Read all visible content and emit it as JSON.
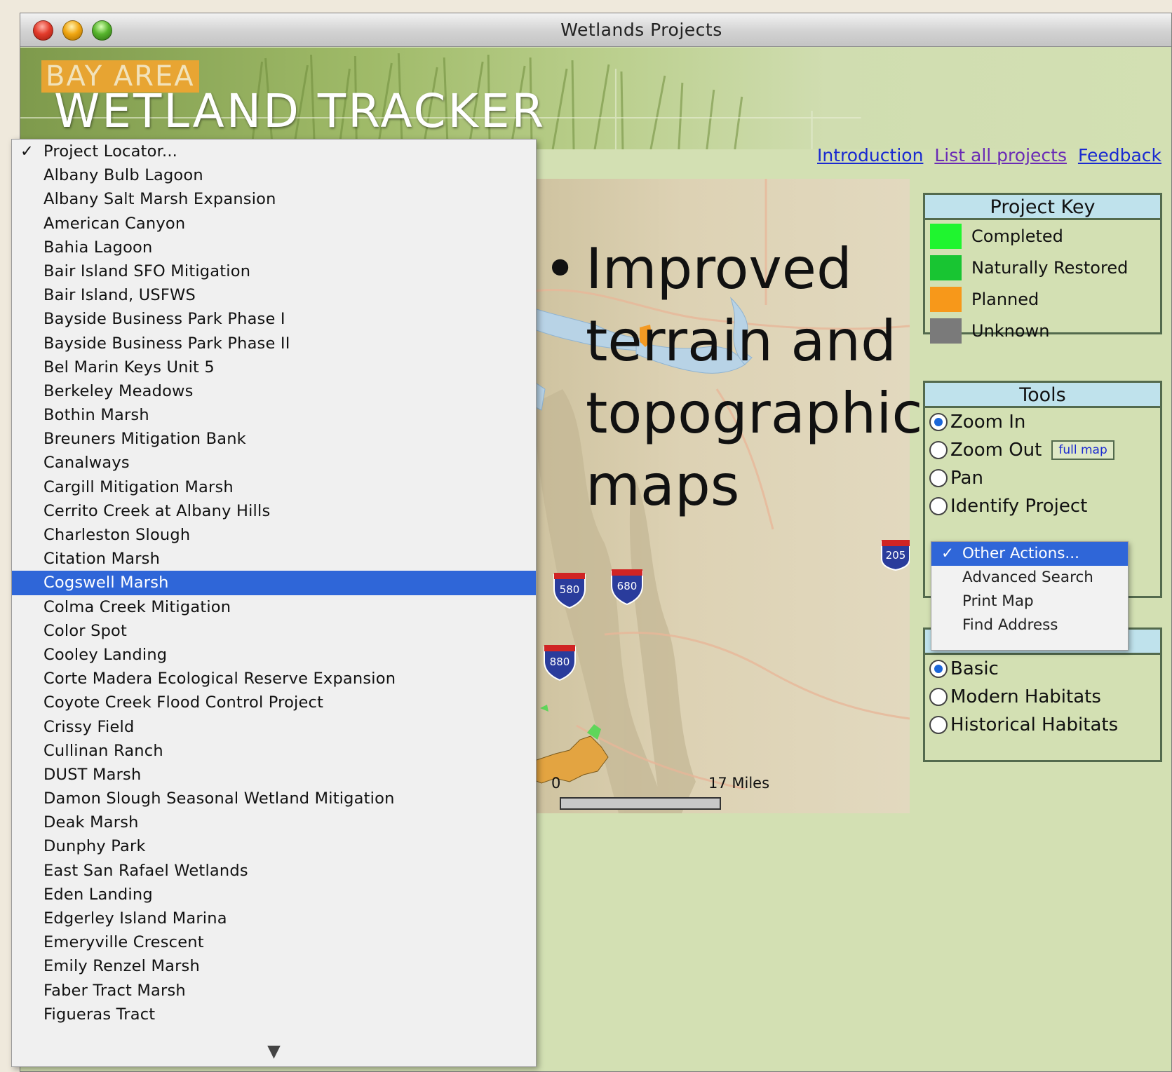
{
  "window": {
    "title": "Wetlands Projects"
  },
  "banner": {
    "brand_sub": "BAY AREA",
    "brand_main": "WETLAND TRACKER"
  },
  "toplinks": {
    "introduction": "Introduction",
    "list_all": "List all projects",
    "feedback": "Feedback"
  },
  "slide_bullet": {
    "dot": "•",
    "text": "Improved terrain and topographic maps"
  },
  "map": {
    "shields": [
      "580",
      "680",
      "880",
      "205"
    ],
    "scale_start": "0",
    "scale_end": "17 Miles"
  },
  "project_key": {
    "title": "Project Key",
    "items": [
      {
        "label": "Completed",
        "color": "#1ff52f"
      },
      {
        "label": "Naturally Restored",
        "color": "#18c532"
      },
      {
        "label": "Planned",
        "color": "#f7981a"
      },
      {
        "label": "Unknown",
        "color": "#7a7a7a"
      }
    ]
  },
  "tools": {
    "title": "Tools",
    "options": [
      "Zoom In",
      "Zoom Out",
      "Pan",
      "Identify Project"
    ],
    "selected": "Zoom In",
    "full_map_label": "full map"
  },
  "map_type": {
    "options": [
      "Basic",
      "Modern Habitats",
      "Historical Habitats"
    ],
    "selected": "Basic"
  },
  "other_actions": {
    "items": [
      "Other Actions...",
      "Advanced Search",
      "Print Map",
      "Find Address"
    ],
    "selected": "Other Actions..."
  },
  "project_locator": {
    "check": "✓",
    "items": [
      "Project Locator...",
      "Albany Bulb Lagoon",
      "Albany Salt Marsh Expansion",
      "American Canyon",
      "Bahia Lagoon",
      "Bair Island SFO Mitigation",
      "Bair Island, USFWS",
      "Bayside Business Park Phase I",
      "Bayside Business Park Phase II",
      "Bel Marin Keys Unit 5",
      "Berkeley Meadows",
      "Bothin Marsh",
      "Breuners Mitigation Bank",
      "Canalways",
      "Cargill Mitigation Marsh",
      "Cerrito Creek at Albany Hills",
      "Charleston Slough",
      "Citation Marsh",
      "Cogswell Marsh",
      "Colma Creek Mitigation",
      "Color Spot",
      "Cooley Landing",
      "Corte Madera Ecological Reserve Expansion",
      "Coyote Creek Flood Control Project",
      "Crissy Field",
      "Cullinan Ranch",
      "DUST Marsh",
      "Damon Slough Seasonal Wetland Mitigation",
      "Deak Marsh",
      "Dunphy Park",
      "East San Rafael Wetlands",
      "Eden Landing",
      "Edgerley Island Marina",
      "Emeryville Crescent",
      "Emily Renzel Marsh",
      "Faber Tract Marsh",
      "Figueras Tract"
    ],
    "checked_item": "Project Locator...",
    "highlighted_item": "Cogswell Marsh",
    "scroll_arrow": "▼"
  }
}
